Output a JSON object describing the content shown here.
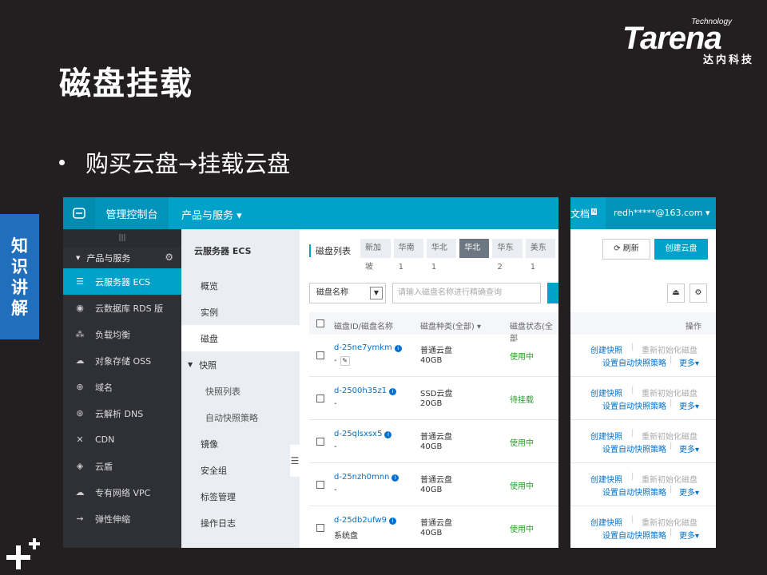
{
  "slide": {
    "title": "磁盘挂载",
    "bullet": "购买云盘→挂载云盘",
    "side_tab": [
      "知",
      "识",
      "讲",
      "解"
    ]
  },
  "logo": {
    "technology": "Technology",
    "brand": "Tarena",
    "chinese": "达内科技"
  },
  "console": {
    "topbar": {
      "console_label": "管理控制台",
      "products_label": "产品与服务 ▾",
      "docs_label": "文档",
      "docs_badge": "N",
      "user": "redh*****@163.com ▾"
    },
    "nav": {
      "collapse": "|||",
      "header": "产品与服务",
      "items": [
        {
          "icon": "server-icon",
          "glyph": "☰",
          "label": "云服务器 ECS"
        },
        {
          "icon": "database-icon",
          "glyph": "◉",
          "label": "云数据库 RDS 版"
        },
        {
          "icon": "load-balancer-icon",
          "glyph": "⁂",
          "label": "负载均衡"
        },
        {
          "icon": "cloud-storage-icon",
          "glyph": "☁",
          "label": "对象存储 OSS"
        },
        {
          "icon": "globe-icon",
          "glyph": "⊕",
          "label": "域名"
        },
        {
          "icon": "dns-icon",
          "glyph": "⊛",
          "label": "云解析 DNS"
        },
        {
          "icon": "cdn-icon",
          "glyph": "✕",
          "label": "CDN"
        },
        {
          "icon": "shield-icon",
          "glyph": "◈",
          "label": "云盾"
        },
        {
          "icon": "vpc-icon",
          "glyph": "☁",
          "label": "专有网络 VPC"
        },
        {
          "icon": "elastic-scaling-icon",
          "glyph": "⇝",
          "label": "弹性伸缩"
        }
      ]
    },
    "subnav": {
      "title": "云服务器 ECS",
      "items": {
        "overview": "概览",
        "instances": "实例",
        "disks": "磁盘",
        "snapshots": "快照",
        "snapshot_list": "快照列表",
        "auto_snapshot_policy": "自动快照策略",
        "images": "镜像",
        "security_groups": "安全组",
        "tag_management": "标签管理",
        "operation_log": "操作日志"
      }
    },
    "content": {
      "list_title": "磁盘列表",
      "regions": [
        "新加坡",
        "华南 1",
        "华北 1",
        "华北 2",
        "华东 2",
        "美东 1"
      ],
      "active_region": "华北 2",
      "search_select": "磁盘名称",
      "search_placeholder": "请输入磁盘名称进行精确查询",
      "refresh_label": "刷新",
      "create_label": "创建云盘",
      "columns": {
        "id": "磁盘ID/磁盘名称",
        "type": "磁盘种类(全部) ▾",
        "status": "磁盘状态(全部",
        "actions": "操作"
      },
      "rows": [
        {
          "id": "d-25ne7ymkm",
          "name": "-",
          "type": "普通云盘",
          "size": "40GB",
          "status": "使用中",
          "status_color": "#2a9a2a"
        },
        {
          "id": "d-2500h35z1",
          "name": "-",
          "type": "SSD云盘",
          "size": "20GB",
          "status": "待挂载",
          "status_color": "#2a9a2a"
        },
        {
          "id": "d-25qlsxsx5",
          "name": "-",
          "type": "普通云盘",
          "size": "40GB",
          "status": "使用中",
          "status_color": "#2a9a2a"
        },
        {
          "id": "d-25nzh0mnn",
          "name": "-",
          "type": "普通云盘",
          "size": "40GB",
          "status": "使用中",
          "status_color": "#2a9a2a"
        },
        {
          "id": "d-25db2ufw9",
          "name": "系统盘",
          "type": "普通云盘",
          "size": "40GB",
          "status": "使用中",
          "status_color": "#2a9a2a"
        }
      ],
      "row_actions": {
        "create_snapshot": "创建快照",
        "separator": "|",
        "reinit": "重新初始化磁盘",
        "auto_policy": "设置自动快照策略",
        "more": "更多▾"
      }
    }
  }
}
